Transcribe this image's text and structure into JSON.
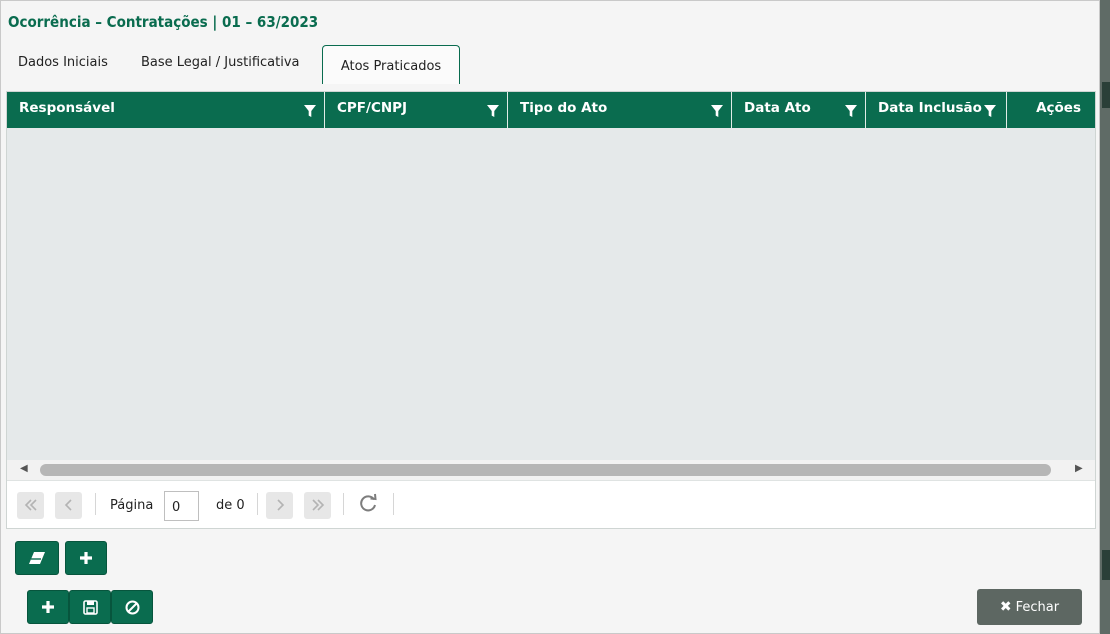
{
  "dialog": {
    "title": "Ocorrência – Contratações | 01 – 63/2023"
  },
  "tabs": [
    {
      "label": "Dados Iniciais",
      "active": false
    },
    {
      "label": "Base Legal / Justificativa",
      "active": false
    },
    {
      "label": "Atos Praticados",
      "active": true
    }
  ],
  "grid": {
    "columns": [
      {
        "label": "Responsável",
        "filter_icon": "filter-icon"
      },
      {
        "label": "CPF/CNPJ",
        "filter_icon": "filter-icon"
      },
      {
        "label": "Tipo do Ato",
        "filter_icon": "filter-icon"
      },
      {
        "label": "Data Ato",
        "filter_icon": "filter-icon"
      },
      {
        "label": "Data Inclusão",
        "filter_icon": "filter-icon"
      },
      {
        "label": "Ações"
      }
    ],
    "rows": []
  },
  "pager": {
    "page_label": "Página",
    "page_value": "0",
    "of_label": "de 0",
    "first_icon": "double-chevron-left-icon",
    "prev_icon": "chevron-left-icon",
    "next_icon": "chevron-right-icon",
    "last_icon": "double-chevron-right-icon",
    "refresh_icon": "refresh-icon"
  },
  "actions": {
    "eraser_icon": "eraser-icon",
    "add_icon": "plus-icon",
    "save_icon": "floppy-disk-icon",
    "cancel_icon": "ban-icon",
    "close_label": "Fechar",
    "close_icon": "times-icon"
  },
  "colors": {
    "primary": "#0a6c4f",
    "grid_body": "#e5e9ea",
    "close_button": "#5d6762"
  }
}
